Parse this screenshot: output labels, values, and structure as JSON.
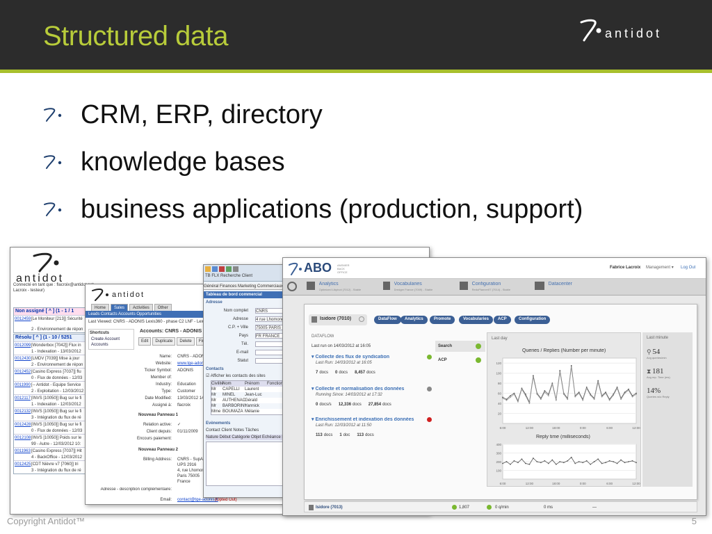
{
  "header": {
    "title": "Structured data",
    "logo_text": "antidot"
  },
  "bullets": [
    "CRM, ERP, directory",
    "knowledge bases",
    "business applications (production, support)"
  ],
  "footer": {
    "copyright": "Copyright Antidot™",
    "page": "5"
  },
  "colors": {
    "accent": "#b8cc3a",
    "header_bg": "#2c2c2c",
    "crm_blue": "#3f6fb5"
  },
  "win1": {
    "logo_word": "antidot",
    "connected": "Connecté en tant que : flacroix@antidot.net",
    "connected2": "Lacroix - testeur)",
    "sec1_title": "Non assigné [ ^ ] (1 - 1 / 1",
    "sec1_rows": [
      {
        "id": "0012459",
        "text": "[Le Moniteur [213]] Sécurité"
      },
      {
        "id": "",
        "text": "2 - Environnement de répon"
      }
    ],
    "sec2_title": "Résolu [ ^ ] (1 - 10 / 5251",
    "sec2_rows": [
      {
        "id": "0012099",
        "text": "[Wonderbox [7042]] Flux in"
      },
      {
        "id": "",
        "text": "1 - Indexation - 13/03/2012"
      },
      {
        "id": "0012430",
        "text": "[LMDV [7039]] Mise à jour"
      },
      {
        "id": "",
        "text": "2 - Environnement de répon"
      },
      {
        "id": "0012452",
        "text": "[Casino Express [7037]] flu"
      },
      {
        "id": "",
        "text": "0 - Flux de données - 12/03"
      },
      {
        "id": "0011990",
        "text": "[-- Antidot - Equipe Service"
      },
      {
        "id": "",
        "text": "2 - Exploitation - 12/03/2012"
      },
      {
        "id": "0012117",
        "text": "[INVS [10050]] Bug sur le fi"
      },
      {
        "id": "",
        "text": "1 - Indexation - 12/03/2012"
      },
      {
        "id": "0012132",
        "text": "[INVS [10050]] Bug sur le fi"
      },
      {
        "id": "",
        "text": "3 - Intégration du flux de ré"
      },
      {
        "id": "0012428",
        "text": "[INVS [10050]] Bug sur le fi"
      },
      {
        "id": "",
        "text": "0 - Flux de données - 12/03"
      },
      {
        "id": "0012108",
        "text": "[INVS [10050]] Poids sur le"
      },
      {
        "id": "",
        "text": "99 - Autre - 12/03/2012 10:"
      },
      {
        "id": "0011963",
        "text": "[Casino Express [7037]] Hit"
      },
      {
        "id": "",
        "text": "4 - BackOffice - 12/03/2012"
      },
      {
        "id": "0012425",
        "text": "[CDT Nièvre v7 [7060]] tri"
      },
      {
        "id": "",
        "text": "3 - Intégration du flux de ré"
      }
    ]
  },
  "win2": {
    "tabs": [
      "Home",
      "Sales",
      "Activities",
      "Other"
    ],
    "subnav": "Leads   Contacts   Accounts   Opportunities",
    "last_viewed": "Last Viewed:   CNRS - ADONIS   Lexis360 - phase C2   LNF - Lexis N",
    "shortcuts": "Shortcuts",
    "create_account": "Create Account",
    "accounts": "Accounts",
    "account_title": "Accounts: CNRS - ADONIS",
    "actions": [
      "Edit",
      "Duplicate",
      "Delete",
      "Find De"
    ],
    "fields": [
      {
        "label": "Name:",
        "value": "CNRS - ADONIS"
      },
      {
        "label": "Website:",
        "value": "www.tge-adonis.fr"
      },
      {
        "label": "Ticker Symbol:",
        "value": "ADONIS"
      },
      {
        "label": "Member of:",
        "value": ""
      },
      {
        "label": "Industry:",
        "value": "Education"
      },
      {
        "label": "Type:",
        "value": "Customer"
      },
      {
        "label": "Date Modified:",
        "value": "13/03/2012 14:41"
      },
      {
        "label": "Assigné à:",
        "value": "flacroix"
      }
    ],
    "panel1": "Nouveau Panneau 1",
    "fields2": [
      {
        "label": "Relation active:",
        "value": "✓"
      },
      {
        "label": "Client depuis:",
        "value": "01/11/2009"
      },
      {
        "label": "Encours paiement:",
        "value": ""
      }
    ],
    "panel2": "Nouveau Panneau 2",
    "billing_label": "Billing Address:",
    "billing_lines": [
      "CNRS - SupADON",
      "UPS 2916",
      "4, rue Lhomond",
      "Paris  75005",
      "France"
    ],
    "desc_label": "Adresse - description complémentaire:",
    "email_label": "Email:",
    "email_value": "contact@tge-adonis.fr",
    "opted_out": "(Opted Out)"
  },
  "win3": {
    "tabs": "TB FLX   Recherche Client",
    "subtabs": "Général  Finances  Marketing  Commerciaux  Infor",
    "title": "Tableau de bord commercial",
    "adresse_head": "Adresse",
    "fields": [
      {
        "label": "Nom complet",
        "value": "CNRS"
      },
      {
        "label": "Adresse",
        "value": "4 rue Lhomond"
      },
      {
        "label": "C.P. + Ville",
        "value": "75005   PARIS"
      },
      {
        "label": "Pays",
        "value": "FR    FRANCE"
      },
      {
        "label": "Tél.",
        "value": ""
      },
      {
        "label": "E-mail",
        "value": ""
      },
      {
        "label": "Statut",
        "value": ""
      }
    ],
    "contacts_head": "Contacts",
    "contacts_check": "Afficher les contacts des sites",
    "contact_cols": [
      "Civilité",
      "Nom",
      "Prénom",
      "Fonction"
    ],
    "contacts": [
      {
        "civ": "Mr",
        "nom": "CAPELLI",
        "prenom": "Laurent"
      },
      {
        "civ": "Mr",
        "nom": "MINEL",
        "prenom": "Jean-Luc"
      },
      {
        "civ": "Mr",
        "nom": "AUTHENAC",
        "prenom": "Gérald"
      },
      {
        "civ": "Mr",
        "nom": "BARBORINI",
        "prenom": "Yannick"
      },
      {
        "civ": "Mme",
        "nom": "BOUMAZA",
        "prenom": "Mélanie"
      }
    ],
    "events_head": "Evènements",
    "radio": "Contact   Client   Notes   Tâches",
    "events_cols": "Nature  Début  Catégorie  Objet  Échéance  Prio"
  },
  "win4": {
    "brand": "ABO",
    "brand_sub": "ANSWER BACK OFFICE",
    "user": "Fabrice Lacroix",
    "management": "Management ▾",
    "logout": "Log Out",
    "nav": [
      {
        "title": "Analytics",
        "sub": "Optimized Libpivot (7012) - Stable"
      },
      {
        "title": "Vocabularies",
        "sub": "Dredger France (7009) - Stable"
      },
      {
        "title": "Configuration",
        "sub": "RedoPlanner07 (7014) - Stable"
      },
      {
        "title": "Datacenter",
        "sub": ""
      }
    ],
    "service": "Isidore (7010)",
    "pills": [
      "DataFlow",
      "Analytics",
      "Promote",
      "Vocabularies",
      "ACP",
      "Configuration"
    ],
    "dataflow": "DATAFLOW",
    "last_run": "Last run on 14/03/2012 at 16:05",
    "flows": [
      {
        "title": "Collecte des flux de syndication",
        "sub": "Last Run: 14/03/2012 at 16:05",
        "a": "7",
        "a_unit": "docs",
        "b": "0",
        "b_unit": "docs",
        "c": "8,457",
        "c_unit": "docs"
      },
      {
        "title": "Collecte et normalisation des données",
        "sub": "Running Since: 14/03/2012 at 17:32",
        "a": "0",
        "a_unit": "docs/s",
        "b": "12,336",
        "b_unit": "docs",
        "c": "27,854",
        "c_unit": "docs"
      },
      {
        "title": "Enrichissement et indexation des données",
        "sub": "Last Run: 12/03/2012 at 11:50",
        "a": "113",
        "a_unit": "docs",
        "b": "1",
        "b_unit": "doc",
        "c": "113",
        "c_unit": "docs"
      }
    ],
    "sidebar": [
      "Search",
      "ACP"
    ],
    "last_day": "Last day",
    "last_minute": "Last minute",
    "queries_title": "Queries / Replies (Number per minute)",
    "reply_title": "Reply time (milliseconds)",
    "q_y_ticks": [
      "120",
      "100",
      "80",
      "60",
      "40",
      "20"
    ],
    "x_ticks": [
      "6:00",
      "12:00",
      "18:00",
      "0:00",
      "6:00",
      "12:00"
    ],
    "r_y_ticks": [
      "400",
      "300",
      "200",
      "100"
    ],
    "stat1": "54",
    "stat1_label": "Avg queries/min",
    "stat2": "181",
    "stat2_label": "Avg rep. Time (ms)",
    "stat3": "14%",
    "stat3_label": "Queries w/o Reply",
    "bottom_service": "Isidore (7013)",
    "bottom_a": "1,807",
    "bottom_b": "0 q/min",
    "bottom_c": "0 ms",
    "bottom_d": "—"
  },
  "chart_data": [
    {
      "type": "line",
      "title": "Queries / Replies (Number per minute)",
      "ylim": [
        0,
        130
      ],
      "x": [
        "6:00",
        "12:00",
        "18:00",
        "0:00",
        "6:00",
        "12:00"
      ],
      "series": [
        {
          "name": "Queries",
          "values": [
            52,
            48,
            55,
            60,
            45,
            70,
            58,
            42,
            95,
            60,
            50,
            65,
            58,
            80,
            48,
            105,
            60,
            50,
            115,
            55,
            62,
            48,
            72,
            58,
            50,
            85,
            55,
            62,
            48,
            58,
            72,
            50,
            62,
            68,
            55,
            60
          ]
        },
        {
          "name": "Replies",
          "values": [
            50,
            46,
            52,
            58,
            43,
            68,
            55,
            40,
            92,
            58,
            48,
            62,
            55,
            78,
            46,
            102,
            58,
            48,
            112,
            53,
            60,
            46,
            70,
            56,
            48,
            82,
            53,
            60,
            46,
            56,
            70,
            48,
            60,
            66,
            53,
            58
          ]
        }
      ]
    },
    {
      "type": "line",
      "title": "Reply time (milliseconds)",
      "ylim": [
        0,
        400
      ],
      "x": [
        "6:00",
        "12:00",
        "18:00",
        "0:00",
        "6:00",
        "12:00"
      ],
      "series": [
        {
          "name": "Reply time",
          "values": [
            180,
            200,
            170,
            210,
            190,
            230,
            180,
            170,
            240,
            200,
            190,
            210,
            180,
            220,
            170,
            200,
            190,
            210,
            250,
            180,
            200,
            190,
            210,
            170,
            200,
            230,
            180,
            190,
            210,
            200,
            180,
            220,
            190,
            200,
            210,
            190
          ]
        }
      ]
    }
  ]
}
